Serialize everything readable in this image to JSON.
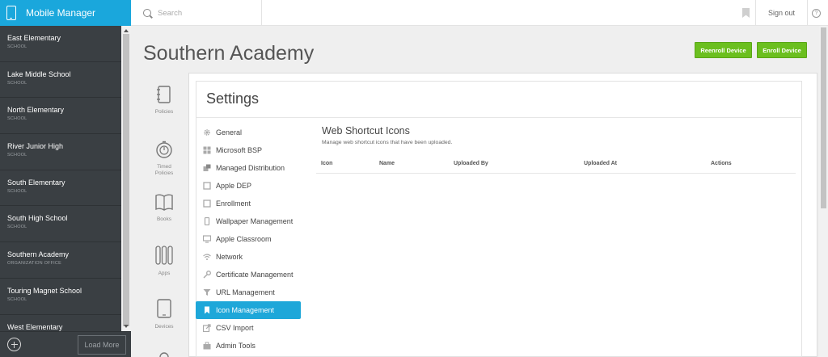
{
  "app": {
    "title": "Mobile Manager"
  },
  "schools": [
    {
      "name": "East Elementary",
      "type": "SCHOOL"
    },
    {
      "name": "Lake Middle School",
      "type": "SCHOOL"
    },
    {
      "name": "North Elementary",
      "type": "SCHOOL"
    },
    {
      "name": "River Junior High",
      "type": "SCHOOL"
    },
    {
      "name": "South Elementary",
      "type": "SCHOOL"
    },
    {
      "name": "South High School",
      "type": "SCHOOL"
    },
    {
      "name": "Southern Academy",
      "type": "ORGANIZATION OFFICE"
    },
    {
      "name": "Touring Magnet School",
      "type": "SCHOOL"
    },
    {
      "name": "West Elementary",
      "type": ""
    }
  ],
  "sidebar_footer": {
    "load_more": "Load More"
  },
  "topbar": {
    "search_placeholder": "Search",
    "signout": "Sign out",
    "help": "?"
  },
  "page": {
    "title": "Southern Academy",
    "reenroll": "Reenroll Device",
    "enroll": "Enroll Device"
  },
  "rail": [
    {
      "label": "Policies",
      "icon": "notebook-icon"
    },
    {
      "label": "Timed Policies",
      "icon": "stopwatch-icon"
    },
    {
      "label": "Books",
      "icon": "book-icon"
    },
    {
      "label": "Apps",
      "icon": "apps-utensils-icon"
    },
    {
      "label": "Devices",
      "icon": "tablet-icon"
    }
  ],
  "settings": {
    "title": "Settings",
    "menu": [
      {
        "label": "General",
        "icon": "gear-icon",
        "active": false
      },
      {
        "label": "Microsoft BSP",
        "icon": "windows-icon",
        "active": false
      },
      {
        "label": "Managed Distribution",
        "icon": "distribution-icon",
        "active": false
      },
      {
        "label": "Apple DEP",
        "icon": "square-icon",
        "active": false
      },
      {
        "label": "Enrollment",
        "icon": "square-icon",
        "active": false
      },
      {
        "label": "Wallpaper Management",
        "icon": "phone-icon",
        "active": false
      },
      {
        "label": "Apple Classroom",
        "icon": "monitor-icon",
        "active": false
      },
      {
        "label": "Network",
        "icon": "wifi-icon",
        "active": false
      },
      {
        "label": "Certificate Management",
        "icon": "key-icon",
        "active": false
      },
      {
        "label": "URL Management",
        "icon": "funnel-icon",
        "active": false
      },
      {
        "label": "Icon Management",
        "icon": "bookmark-icon",
        "active": true
      },
      {
        "label": "CSV Import",
        "icon": "import-icon",
        "active": false
      },
      {
        "label": "Admin Tools",
        "icon": "briefcase-icon",
        "active": false
      }
    ],
    "section": {
      "title": "Web Shortcut Icons",
      "subtitle": "Manage web shortcut icons that have been uploaded.",
      "columns": [
        "Icon",
        "Name",
        "Uploaded By",
        "Uploaded At",
        "Actions"
      ]
    }
  },
  "colors": {
    "brand": "#1aa7dc",
    "active": "#1ea7d9",
    "green": "#6bbf1f",
    "sidebar": "#3a3f43"
  }
}
